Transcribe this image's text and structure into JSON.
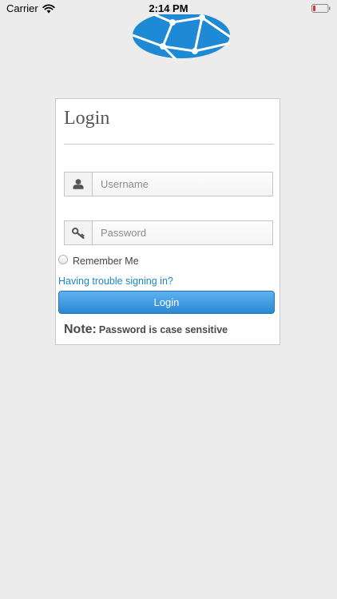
{
  "status_bar": {
    "carrier": "Carrier",
    "time": "2:14 PM",
    "battery_color": "#e0302a"
  },
  "logo": {
    "icon": "globe-network-icon",
    "color": "#1e8ad6"
  },
  "login": {
    "title": "Login",
    "username": {
      "icon": "user-icon",
      "placeholder": "Username",
      "value": ""
    },
    "password": {
      "icon": "key-icon",
      "placeholder": "Password",
      "value": ""
    },
    "remember_label": "Remember Me",
    "remember_checked": false,
    "trouble_link": "Having trouble signing in?",
    "button_label": "Login",
    "note_label": "Note:",
    "note_text": "Password is case sensitive"
  },
  "colors": {
    "background": "#ececec",
    "link": "#1a86c7",
    "button": "#2a88d4"
  }
}
